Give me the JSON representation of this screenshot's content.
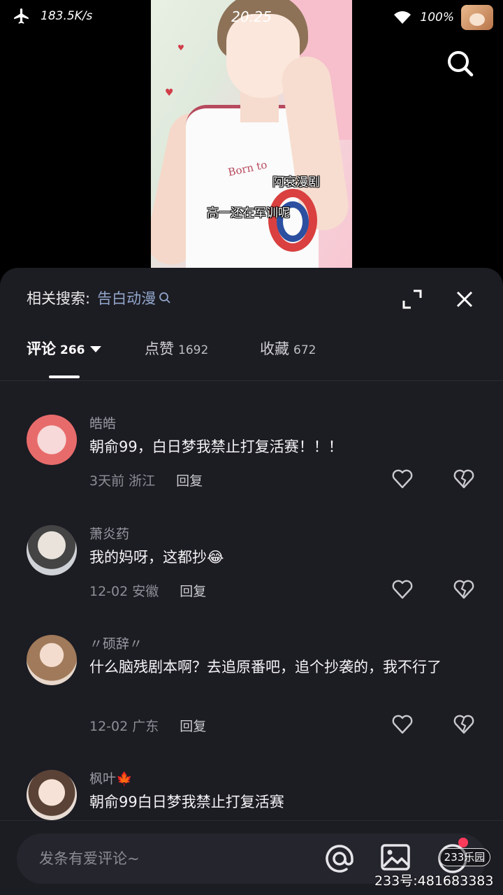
{
  "status_bar": {
    "net_speed": "183.5K/s",
    "time": "20:25",
    "battery": "100%"
  },
  "video": {
    "jersey_text": "Born to",
    "caption_top": "阿衰漫剧",
    "caption_bottom": "高一还在军训呢"
  },
  "sheet": {
    "related_label": "相关搜索:",
    "related_query": "告白动漫",
    "tabs": [
      {
        "label": "评论",
        "count": "266"
      },
      {
        "label": "点赞",
        "count": "1692"
      },
      {
        "label": "收藏",
        "count": "672"
      }
    ],
    "comments": [
      {
        "user": "皓皓",
        "text": "朝俞99，白日梦我禁止打复活赛！！！",
        "time": "3天前",
        "location": "浙江",
        "reply": "回复"
      },
      {
        "user": "萧炎药",
        "text": "我的妈呀，这都抄😂",
        "time": "12-02",
        "location": "安徽",
        "reply": "回复"
      },
      {
        "user": "〃硕辞〃",
        "text": "什么脑残剧本啊？去追原番吧，追个抄袭的，我不行了",
        "time": "12-02",
        "location": "广东",
        "reply": "回复"
      },
      {
        "user": "枫叶🍁",
        "text": "朝俞99白日梦我禁止打复活赛"
      }
    ],
    "input_placeholder": "发条有爱评论~"
  },
  "watermark": {
    "logo": "233乐园",
    "id": "233号:481683383"
  },
  "colors": {
    "sheet_bg": "#1c1c23",
    "link": "#93a7cc",
    "badge": "#ff3b5c"
  }
}
